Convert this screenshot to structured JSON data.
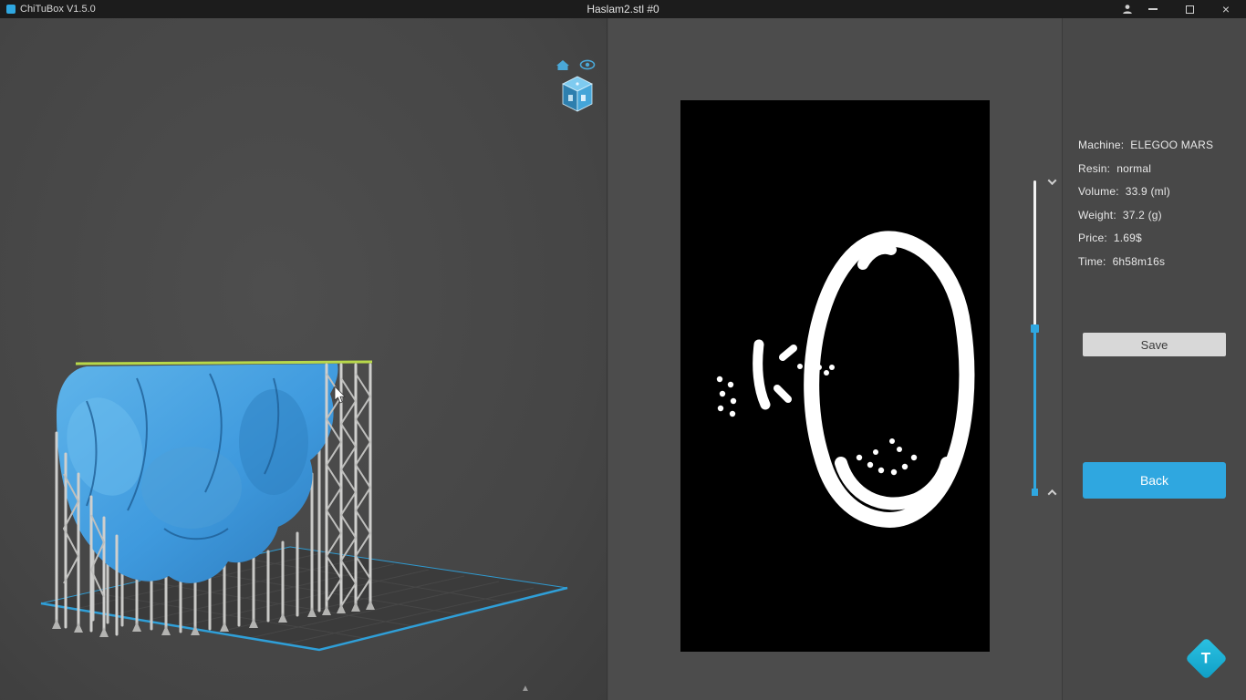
{
  "title_bar": {
    "app_title": "ChiTuBox V1.5.0",
    "document_title": "Haslam2.stl #0"
  },
  "icons": {
    "user": "user-silhouette",
    "minimize": "minimize-bar",
    "maximize": "maximize-box",
    "close": "×",
    "chevron_down": "chevron-down",
    "chevron_up": "chevron-up",
    "expand": "▲",
    "home": "home",
    "eye": "eye",
    "view_cube": "view-cube"
  },
  "right_panel": {
    "info": [
      {
        "label": "Machine:",
        "value": "ELEGOO MARS"
      },
      {
        "label": "Resin:",
        "value": "normal"
      },
      {
        "label": "Volume:",
        "value": "33.9  (ml)"
      },
      {
        "label": "Weight:",
        "value": "37.2  (g)"
      },
      {
        "label": "Price:",
        "value": "1.69$"
      },
      {
        "label": "Time:",
        "value": "6h58m16s"
      }
    ],
    "save_label": "Save",
    "back_label": "Back"
  },
  "watermark": {
    "letter": "T"
  },
  "colors": {
    "accent": "#2fa7e0",
    "model_blue": "#3f9ade",
    "support_gray": "#c8c8c6",
    "slice_fg": "#ffffff",
    "slice_bg": "#000000",
    "titlebar_bg": "#1c1c1c"
  }
}
